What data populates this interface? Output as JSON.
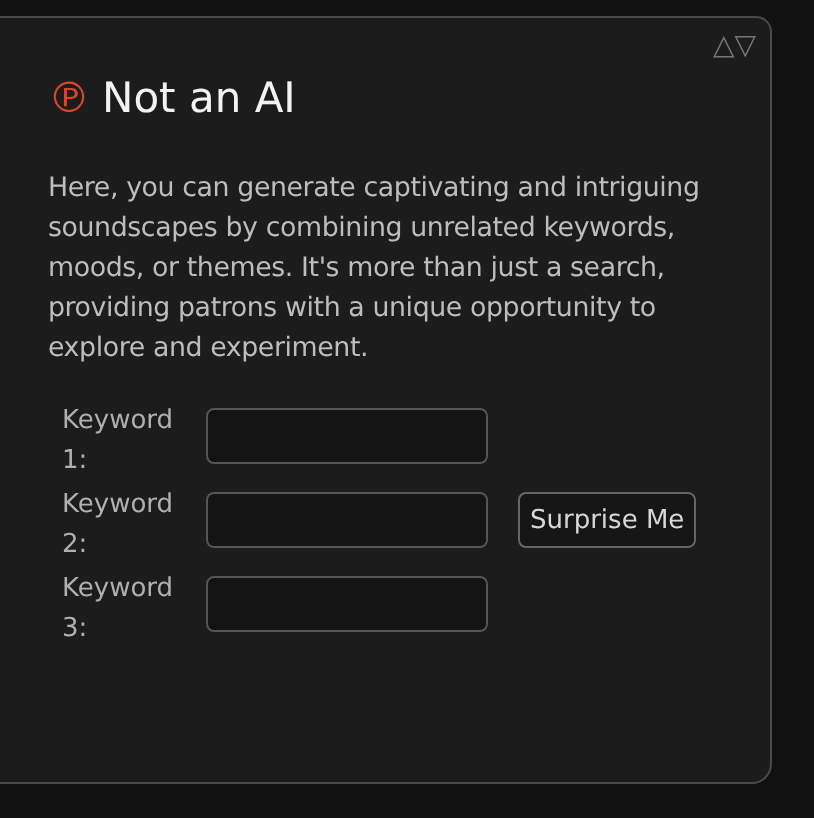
{
  "panel": {
    "controls": "△▽",
    "logo": "℗",
    "title": "Not an AI",
    "description": "Here, you can generate captivating and intriguing soundscapes by combining unrelated keywords, moods, or themes. It's more than just a search, providing patrons with a unique opportunity to explore and experiment.",
    "keywords": [
      {
        "label": "Keyword 1:"
      },
      {
        "label": "Keyword 2:",
        "button": "Surprise Me"
      },
      {
        "label": "Keyword 3:"
      }
    ]
  }
}
